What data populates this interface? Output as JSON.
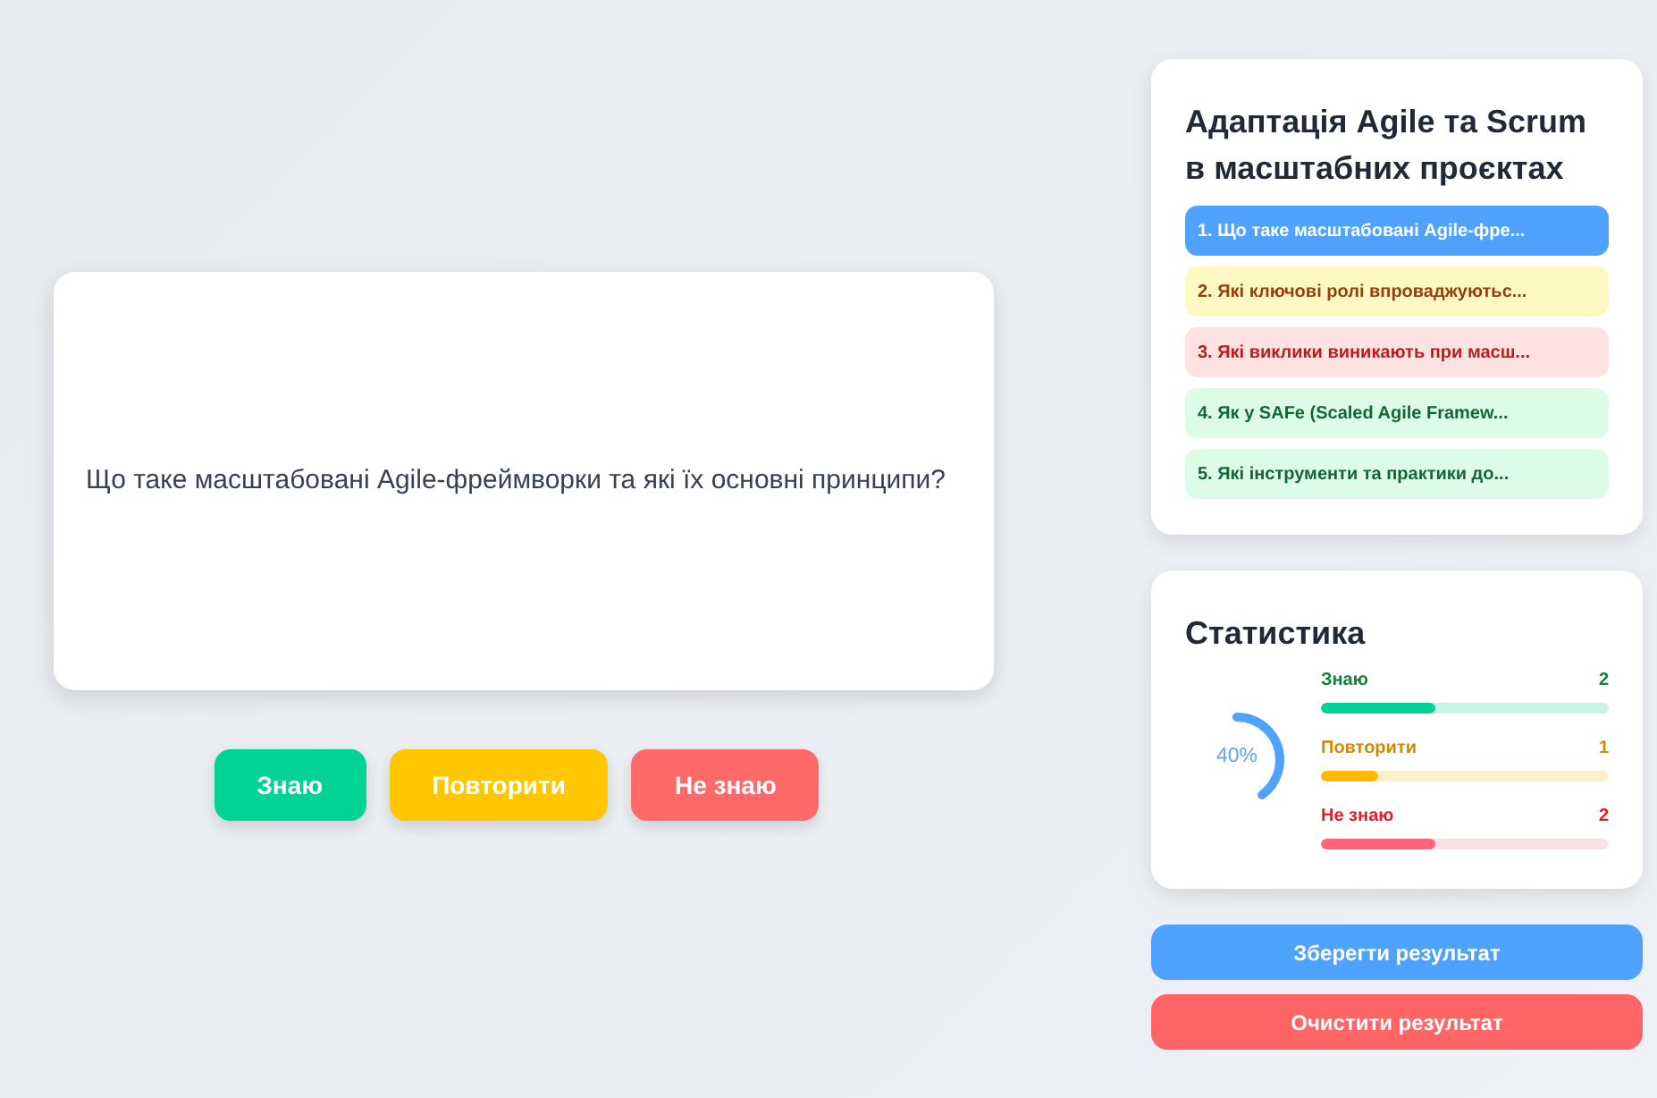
{
  "card": {
    "question": "Що таке масштабовані Agile-фреймворки та які їх основні принципи?"
  },
  "answer_buttons": [
    {
      "label": "Знаю",
      "kind": "know"
    },
    {
      "label": "Повторити",
      "kind": "repeat"
    },
    {
      "label": "Не знаю",
      "kind": "dontknow"
    }
  ],
  "topic": {
    "title": "Адаптація Agile та Scrum в масштабних проєктах",
    "questions": [
      {
        "label": "1. Що таке масштабовані Agile-фре...",
        "selected": true,
        "kind": "none"
      },
      {
        "label": "2. Які ключові ролі впроваджуютьс...",
        "selected": false,
        "kind": "repeat"
      },
      {
        "label": "3. Які виклики виникають при масш...",
        "selected": false,
        "kind": "dontknow"
      },
      {
        "label": "4. Як у SAFe (Scaled Agile Framew...",
        "selected": false,
        "kind": "know"
      },
      {
        "label": "5. Які інструменти та практики до...",
        "selected": false,
        "kind": "know"
      }
    ]
  },
  "stats": {
    "title": "Статистика",
    "progress": {
      "reading": "40%",
      "level": 0.4
    },
    "rows": [
      {
        "label": "Знаю",
        "count": "2",
        "level": 0.4,
        "kind": "know"
      },
      {
        "label": "Повторити",
        "count": "1",
        "level": 0.2,
        "kind": "repeat"
      },
      {
        "label": "Не знаю",
        "count": "2",
        "level": 0.4,
        "kind": "dontknow"
      }
    ]
  },
  "actions": [
    {
      "label": "Зберегти результат",
      "kind": "save"
    },
    {
      "label": "Очистити результат",
      "kind": "clear"
    }
  ]
}
